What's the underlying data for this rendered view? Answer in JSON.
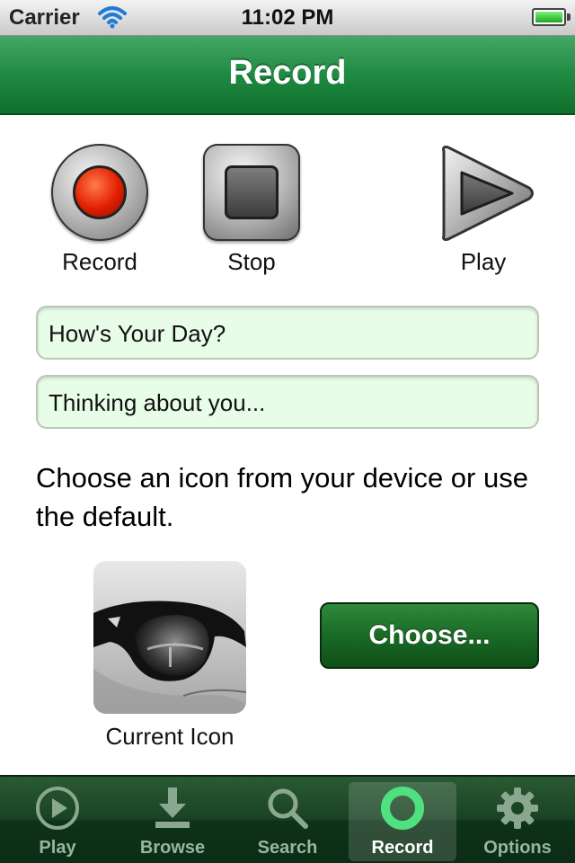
{
  "status_bar": {
    "carrier": "Carrier",
    "time": "11:02 PM"
  },
  "nav": {
    "title": "Record"
  },
  "controls": {
    "record_label": "Record",
    "stop_label": "Stop",
    "play_label": "Play"
  },
  "fields": {
    "title_value": "How's Your Day?",
    "message_value": "Thinking about you..."
  },
  "icon_section": {
    "instructions": "Choose an icon from your device or use the default.",
    "current_icon_caption": "Current Icon",
    "choose_label": "Choose..."
  },
  "tab_bar": {
    "items": [
      {
        "label": "Play",
        "icon": "play-icon"
      },
      {
        "label": "Browse",
        "icon": "download-icon"
      },
      {
        "label": "Search",
        "icon": "search-icon"
      },
      {
        "label": "Record",
        "icon": "record-icon",
        "active": true
      },
      {
        "label": "Options",
        "icon": "gear-icon"
      }
    ]
  },
  "colors": {
    "nav_green": "#1f8a42",
    "field_bg": "#e8fde8",
    "choose_button": "#1a6a26",
    "tab_bar": "#1a4324"
  }
}
